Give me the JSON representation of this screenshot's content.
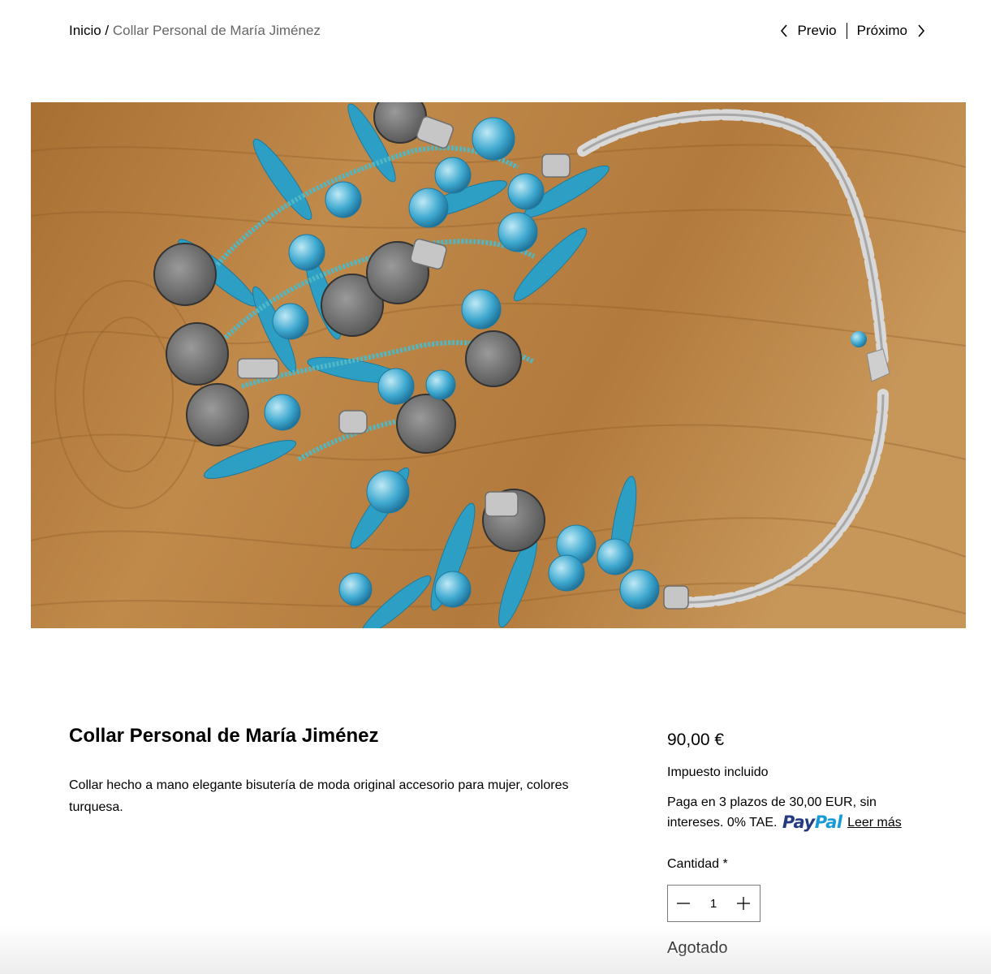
{
  "breadcrumb": {
    "home": "Inicio",
    "separator": " / ",
    "current": "Collar Personal de María Jiménez"
  },
  "pager": {
    "prev": "Previo",
    "next": "Próximo",
    "prev_icon": "chevron-left-icon",
    "next_icon": "chevron-right-icon"
  },
  "product": {
    "title": "Collar Personal de María Jiménez",
    "description": "Collar hecho a mano elegante bisutería de moda original accesorio para mujer, colores turquesa.",
    "image_alt": "Collar turquesa sobre mesa de madera",
    "price": "90,00 €",
    "tax_note": "Impuesto incluido",
    "installments_text": "Paga en 3 plazos de 30,00 EUR, sin intereses. 0% TAE.",
    "paypal_logo": "PayPal",
    "learn_more": "Leer más",
    "quantity_label": "Cantidad *",
    "quantity_value": "1",
    "status": "Agotado"
  },
  "colors": {
    "paypal_dark": "#253b80",
    "paypal_light": "#179bd7",
    "turquoise": "#2a9ec0",
    "wood": "#b07c3d"
  }
}
